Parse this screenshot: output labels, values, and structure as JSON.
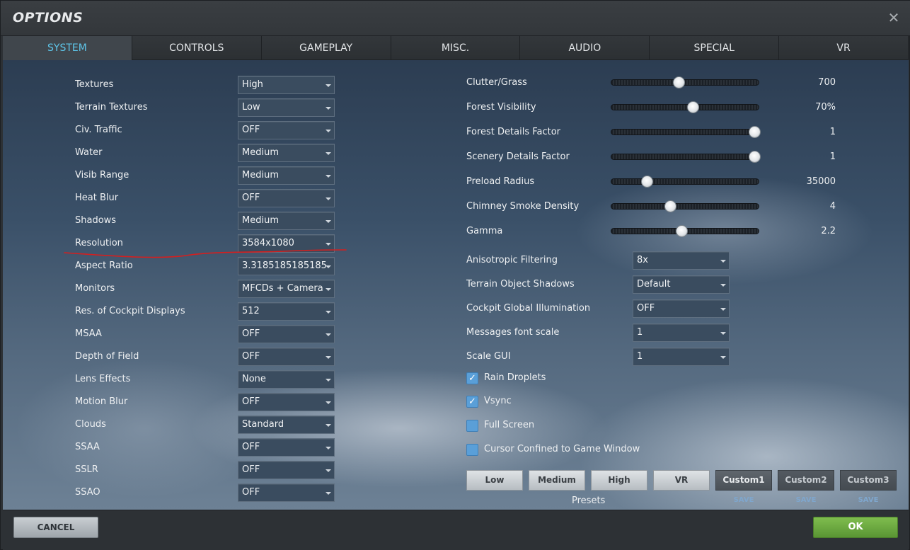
{
  "window": {
    "title": "OPTIONS",
    "close_glyph": "✕"
  },
  "tabs": [
    {
      "label": "SYSTEM",
      "active": true
    },
    {
      "label": "CONTROLS",
      "active": false
    },
    {
      "label": "GAMEPLAY",
      "active": false
    },
    {
      "label": "MISC.",
      "active": false
    },
    {
      "label": "AUDIO",
      "active": false
    },
    {
      "label": "SPECIAL",
      "active": false
    },
    {
      "label": "VR",
      "active": false
    }
  ],
  "left_settings": [
    {
      "label": "Textures",
      "value": "High"
    },
    {
      "label": "Terrain Textures",
      "value": "Low"
    },
    {
      "label": "Civ. Traffic",
      "value": "OFF"
    },
    {
      "label": "Water",
      "value": "Medium"
    },
    {
      "label": "Visib Range",
      "value": "Medium"
    },
    {
      "label": "Heat Blur",
      "value": "OFF"
    },
    {
      "label": "Shadows",
      "value": "Medium"
    },
    {
      "label": "Resolution",
      "value": "3584x1080"
    },
    {
      "label": "Aspect Ratio",
      "value": "3.3185185185185"
    },
    {
      "label": "Monitors",
      "value": "MFCDs + Camera"
    },
    {
      "label": "Res. of Cockpit Displays",
      "value": "512"
    },
    {
      "label": "MSAA",
      "value": "OFF"
    },
    {
      "label": "Depth of Field",
      "value": "OFF"
    },
    {
      "label": "Lens Effects",
      "value": "None"
    },
    {
      "label": "Motion Blur",
      "value": "OFF"
    },
    {
      "label": "Clouds",
      "value": "Standard"
    },
    {
      "label": "SSAA",
      "value": "OFF"
    },
    {
      "label": "SSLR",
      "value": "OFF"
    },
    {
      "label": "SSAO",
      "value": "OFF"
    }
  ],
  "sliders": [
    {
      "label": "Clutter/Grass",
      "value": "700",
      "level": 0.46
    },
    {
      "label": "Forest Visibility",
      "value": "70%",
      "level": 0.56
    },
    {
      "label": "Forest Details Factor",
      "value": "1",
      "level": 1.0
    },
    {
      "label": "Scenery Details Factor",
      "value": "1",
      "level": 1.0
    },
    {
      "label": "Preload Radius",
      "value": "35000",
      "level": 0.23
    },
    {
      "label": "Chimney Smoke Density",
      "value": "4",
      "level": 0.4
    },
    {
      "label": "Gamma",
      "value": "2.2",
      "level": 0.48
    }
  ],
  "right_settings": [
    {
      "label": "Anisotropic Filtering",
      "value": "8x"
    },
    {
      "label": "Terrain Object Shadows",
      "value": "Default"
    },
    {
      "label": "Cockpit Global Illumination",
      "value": "OFF"
    },
    {
      "label": "Messages font scale",
      "value": "1"
    },
    {
      "label": "Scale GUI",
      "value": "1"
    }
  ],
  "checkboxes": [
    {
      "label": "Rain Droplets",
      "checked": true
    },
    {
      "label": "Vsync",
      "checked": true
    },
    {
      "label": "Full Screen",
      "checked": false
    },
    {
      "label": "Cursor Confined to Game Window",
      "checked": false
    }
  ],
  "presets": {
    "caption": "Presets",
    "buttons": [
      {
        "label": "Low",
        "style": "light"
      },
      {
        "label": "Medium",
        "style": "light"
      },
      {
        "label": "High",
        "style": "light"
      },
      {
        "label": "VR",
        "style": "light"
      },
      {
        "label": "Custom1",
        "style": "dark",
        "save": "SAVE"
      },
      {
        "label": "Custom2",
        "style": "dim",
        "save": "SAVE"
      },
      {
        "label": "Custom3",
        "style": "dim",
        "save": "SAVE"
      }
    ]
  },
  "footer": {
    "cancel_label": "CANCEL",
    "ok_label": "OK"
  },
  "colors": {
    "active_tab_text": "#5ec6ea",
    "ok_green": "#6aa83f",
    "annotation_red": "#d41f1f",
    "checkbox_blue": "#5a9fd8"
  }
}
